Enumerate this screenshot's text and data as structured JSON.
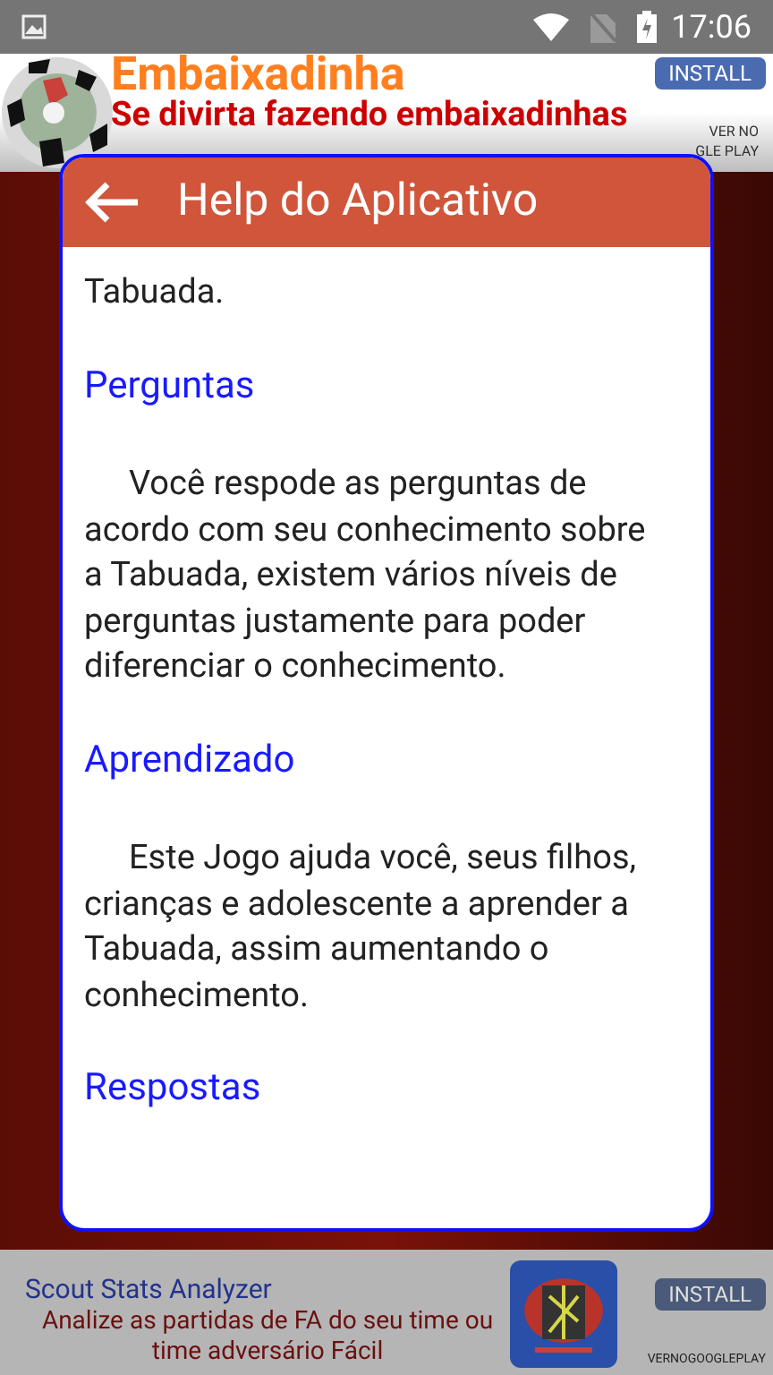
{
  "status_bar": {
    "time": "17:06"
  },
  "top_ad": {
    "title": "Embaixadinha",
    "subtitle": "Se divirta fazendo embaixadinhas",
    "install": "INSTALL",
    "store_line_1": "VER NO",
    "store_line_2": "GLE PLAY"
  },
  "dialog": {
    "title": "Help do Aplicativo",
    "sections": [
      {
        "kind": "paragraph",
        "text": "Tabuada."
      },
      {
        "kind": "heading",
        "text": "Perguntas"
      },
      {
        "kind": "indented_paragraph",
        "text": "Você respode as perguntas de acordo com seu conhecimento sobre a Tabuada, existem vários níveis de perguntas justamente para poder diferenciar o conhecimento."
      },
      {
        "kind": "heading",
        "text": "Aprendizado"
      },
      {
        "kind": "indented_paragraph",
        "text": "Este Jogo ajuda você, seus filhos, crianças e adolescente a aprender a Tabuada, assim aumentando o conhecimento."
      },
      {
        "kind": "heading",
        "text": "Respostas"
      }
    ]
  },
  "bottom_ad": {
    "title": "Scout Stats Analyzer",
    "description": "Analize as partidas de FA do seu time ou time adversário Fácil",
    "install": "INSTALL",
    "store": "VERNOGOOGLEPLAY"
  }
}
